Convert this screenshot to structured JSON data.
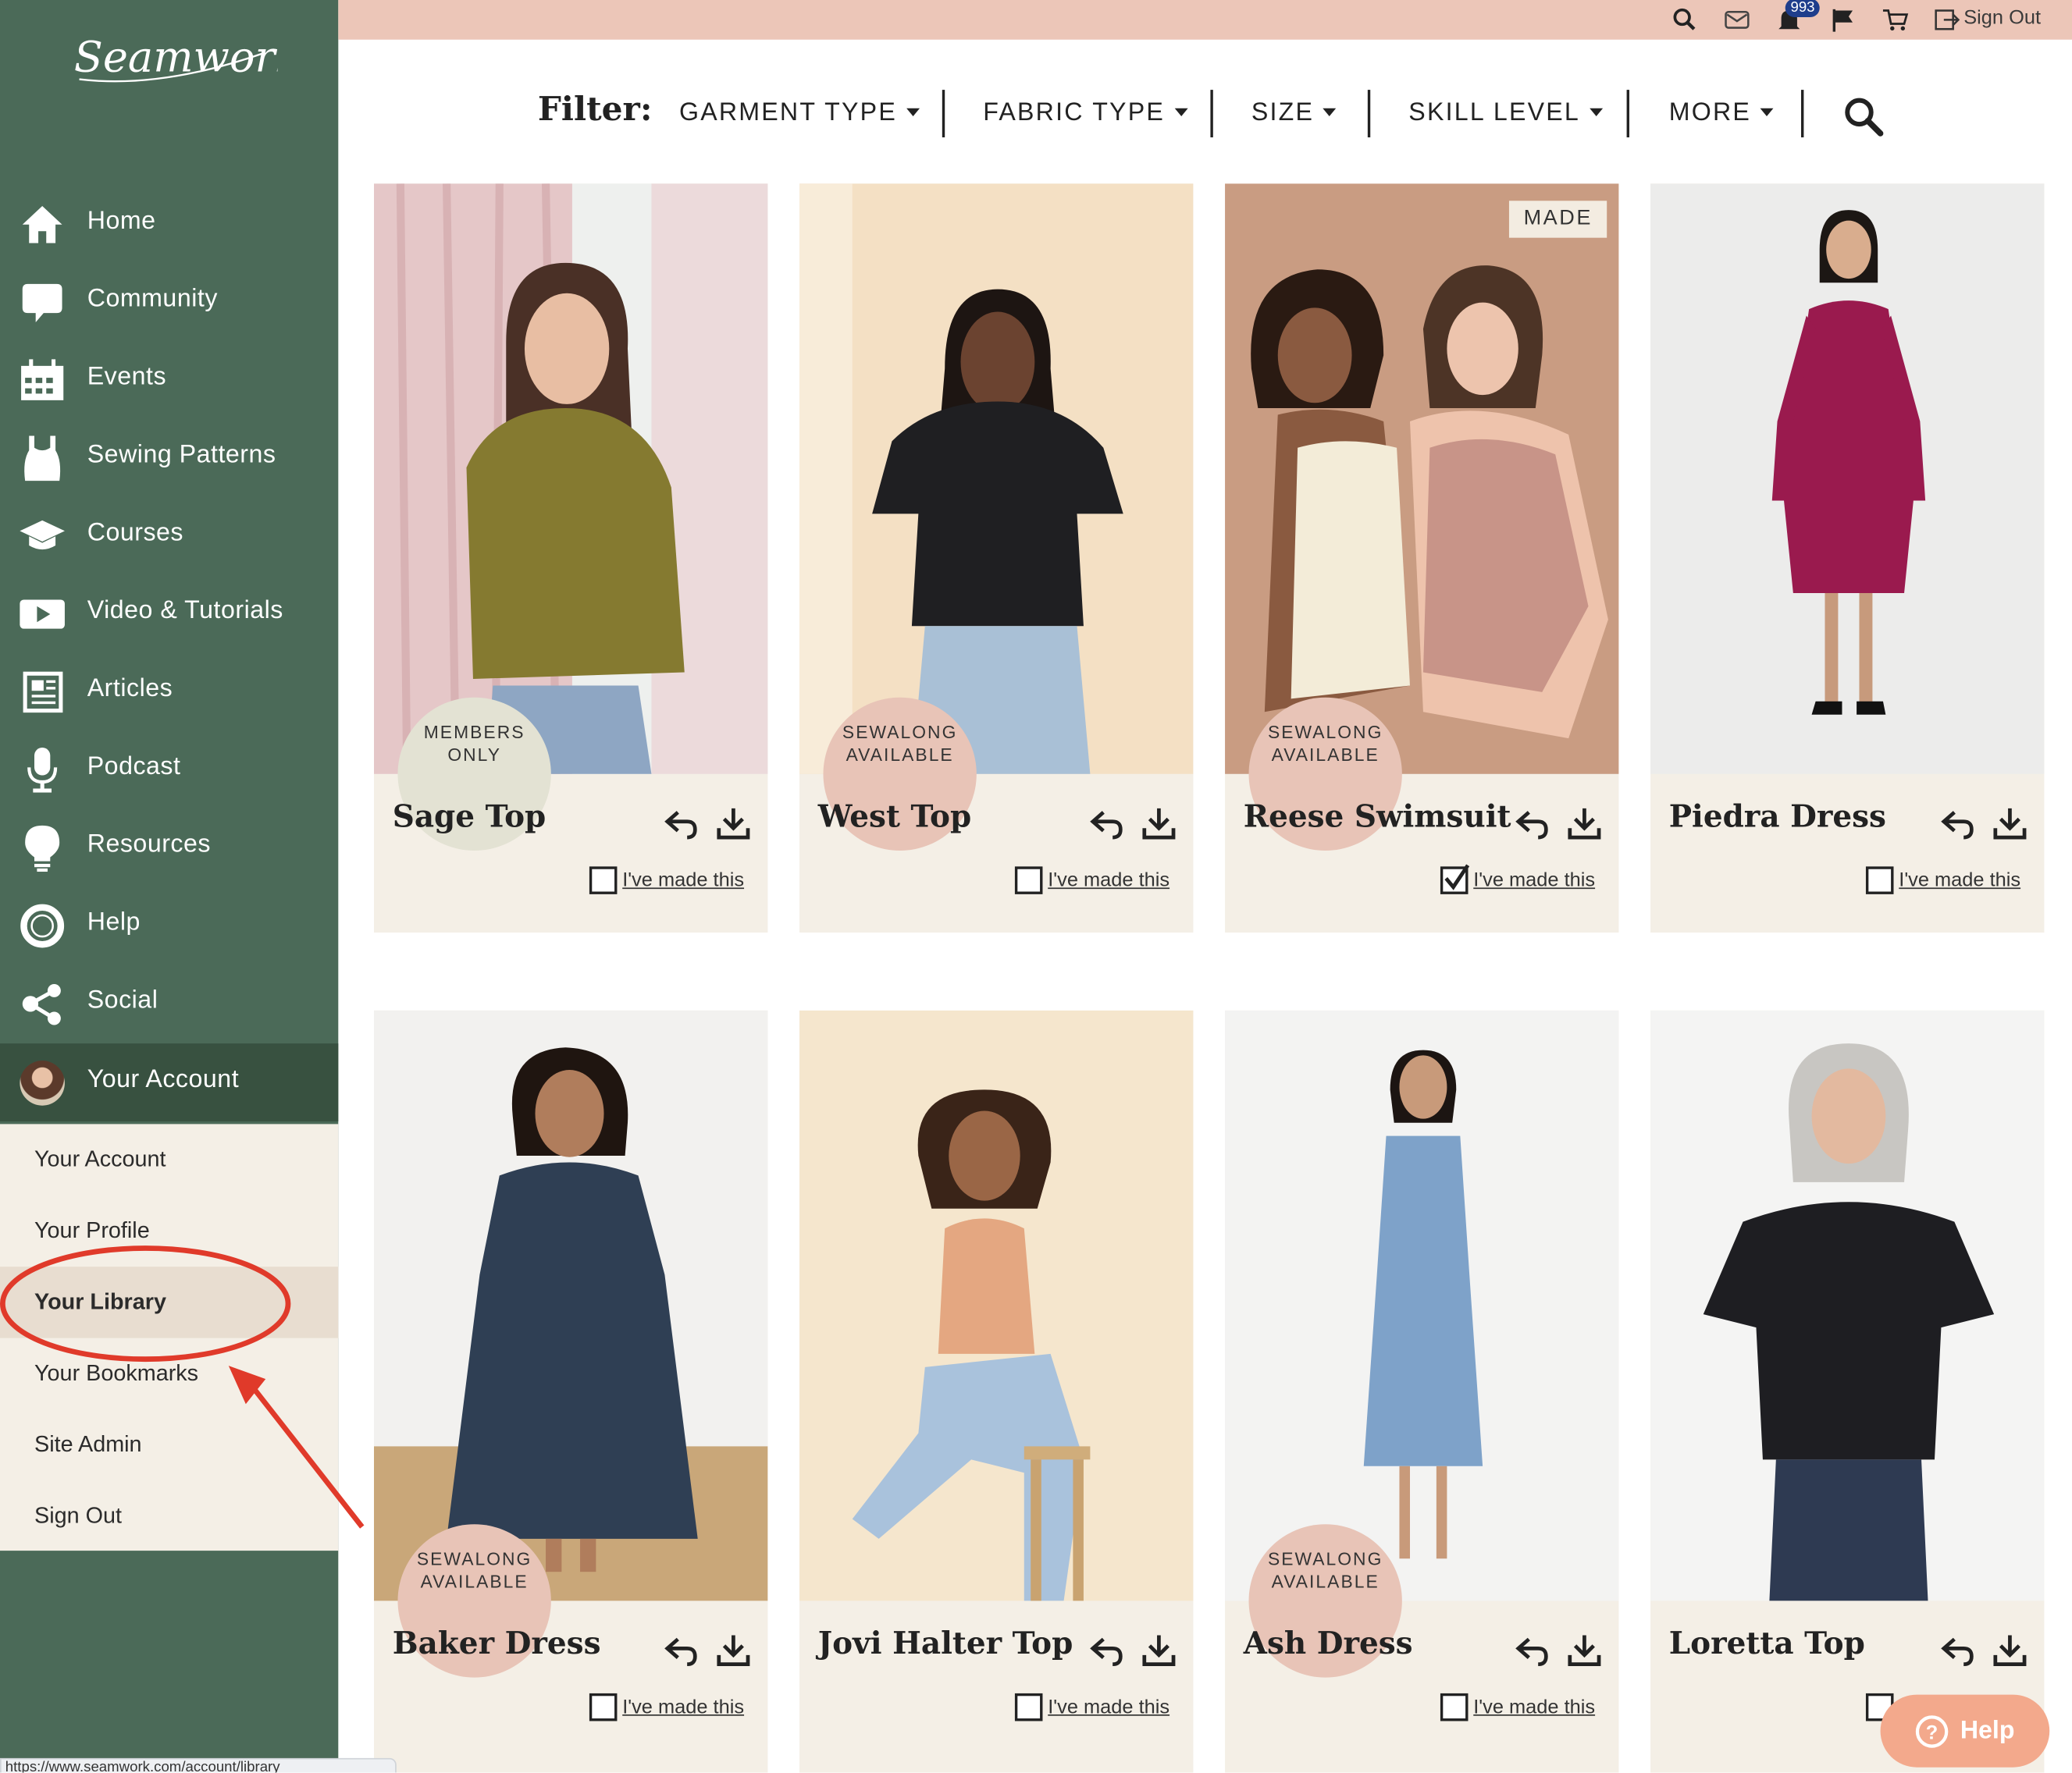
{
  "app": {
    "logo_text": "Seamwork"
  },
  "topbar": {
    "notification_count": "993",
    "sign_out_label": "Sign Out",
    "icons": [
      "search-icon",
      "mail-icon",
      "bell-icon",
      "flag-icon",
      "cart-icon",
      "sign-out-icon"
    ]
  },
  "sidebar": {
    "items": [
      {
        "label": "Home",
        "icon": "home-icon"
      },
      {
        "label": "Community",
        "icon": "chat-bubble-icon"
      },
      {
        "label": "Events",
        "icon": "calendar-icon"
      },
      {
        "label": "Sewing Patterns",
        "icon": "dress-form-icon"
      },
      {
        "label": "Courses",
        "icon": "graduation-cap-icon"
      },
      {
        "label": "Video & Tutorials",
        "icon": "video-play-icon"
      },
      {
        "label": "Articles",
        "icon": "newspaper-icon"
      },
      {
        "label": "Podcast",
        "icon": "microphone-icon"
      },
      {
        "label": "Resources",
        "icon": "lightbulb-icon"
      },
      {
        "label": "Help",
        "icon": "lifebuoy-icon"
      },
      {
        "label": "Social",
        "icon": "share-icon"
      },
      {
        "label": "Your Account",
        "icon": "avatar",
        "active": true
      }
    ],
    "submenu": [
      {
        "label": "Your Account"
      },
      {
        "label": "Your Profile"
      },
      {
        "label": "Your Library",
        "active": true
      },
      {
        "label": "Your Bookmarks"
      },
      {
        "label": "Site Admin"
      },
      {
        "label": "Sign Out"
      }
    ]
  },
  "filter": {
    "label": "Filter:",
    "options": [
      "GARMENT TYPE",
      "FABRIC TYPE",
      "SIZE",
      "SKILL LEVEL",
      "MORE"
    ],
    "search_icon": "search-icon"
  },
  "made_label": "I've made this",
  "patterns": [
    {
      "name": "Sage Top",
      "tag": "MEMBERS ONLY",
      "made": false
    },
    {
      "name": "West Top",
      "tag": "SEWALONG AVAILABLE",
      "made": false
    },
    {
      "name": "Reese Swimsuit",
      "tag": "SEWALONG AVAILABLE",
      "badge": "MADE",
      "made": true
    },
    {
      "name": "Piedra Dress",
      "tag": "",
      "made": false
    },
    {
      "name": "Baker Dress",
      "tag": "SEWALONG AVAILABLE",
      "made": false
    },
    {
      "name": "Jovi Halter Top",
      "tag": "",
      "made": false
    },
    {
      "name": "Ash Dress",
      "tag": "SEWALONG AVAILABLE",
      "made": false
    },
    {
      "name": "Loretta Top",
      "tag": "",
      "made": false
    }
  ],
  "tags": {
    "members_line1": "MEMBERS",
    "members_line2": "ONLY",
    "sewalong_line1": "SEWALONG",
    "sewalong_line2": "AVAILABLE"
  },
  "help_button": {
    "label": "Help"
  },
  "status_url": "https://www.seamwork.com/account/library",
  "colors": {
    "sidebar": "#4b6a58",
    "topbar": "#ecc6b8",
    "card_bg": "#f4efe6",
    "annotation": "#e03a2a",
    "help_button": "#f3a98c"
  }
}
